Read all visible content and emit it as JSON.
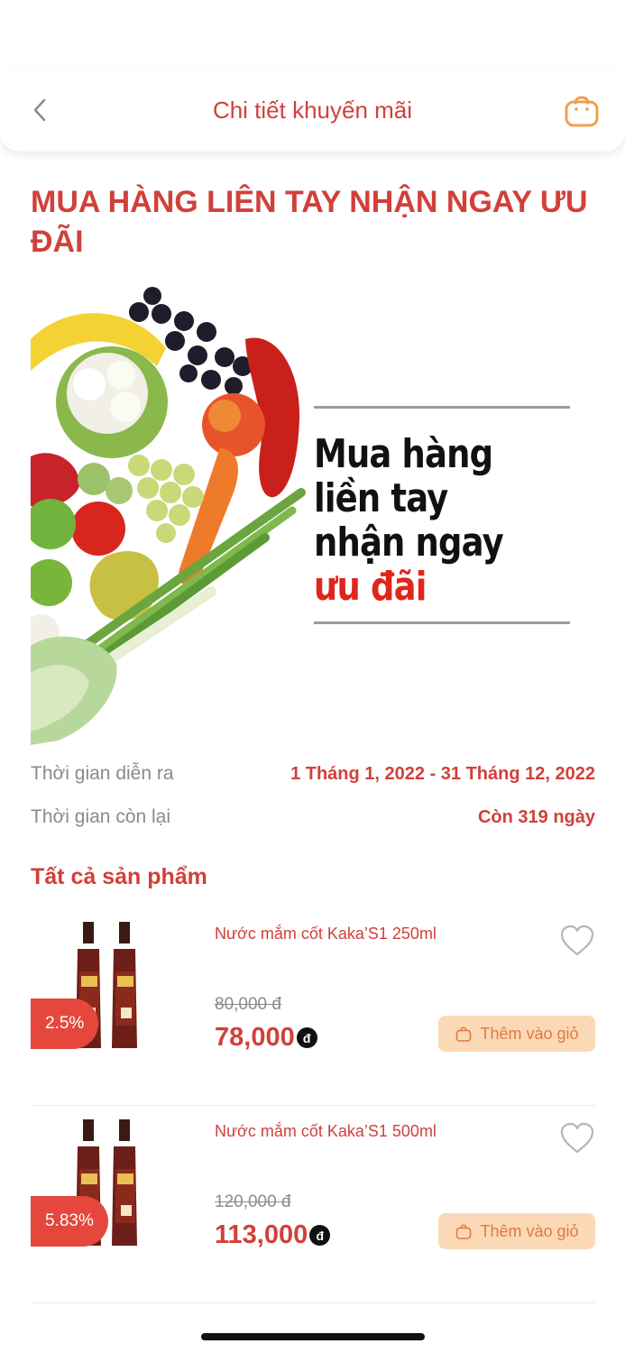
{
  "header": {
    "title": "Chi tiết khuyến mãi",
    "accent": "#d1403a"
  },
  "promo": {
    "title": "MUA HÀNG LIÊN TAY NHẬN NGAY ƯU ĐÃI",
    "banner": {
      "line1": "Mua hàng",
      "line2": "liền tay",
      "line3": "nhận ngay",
      "line4": "ưu đãi"
    },
    "duration_label": "Thời gian diễn ra",
    "duration_value": "1 Tháng 1, 2022 - 31 Tháng 12, 2022",
    "remaining_label": "Thời gian còn lại",
    "remaining_value": "Còn 319 ngày"
  },
  "section": {
    "title": "Tất cả sản phẩm"
  },
  "products": [
    {
      "name": "Nước mắm cốt Kaka’S1 250ml",
      "discount": "2.5%",
      "old_price": "80,000 đ",
      "new_price": "78,000",
      "currency": "đ",
      "add_label": "Thêm vào giỏ"
    },
    {
      "name": "Nước mắm cốt Kaka’S1 500ml",
      "discount": "5.83%",
      "old_price": "120,000 đ",
      "new_price": "113,000",
      "currency": "đ",
      "add_label": "Thêm vào giỏ"
    }
  ]
}
